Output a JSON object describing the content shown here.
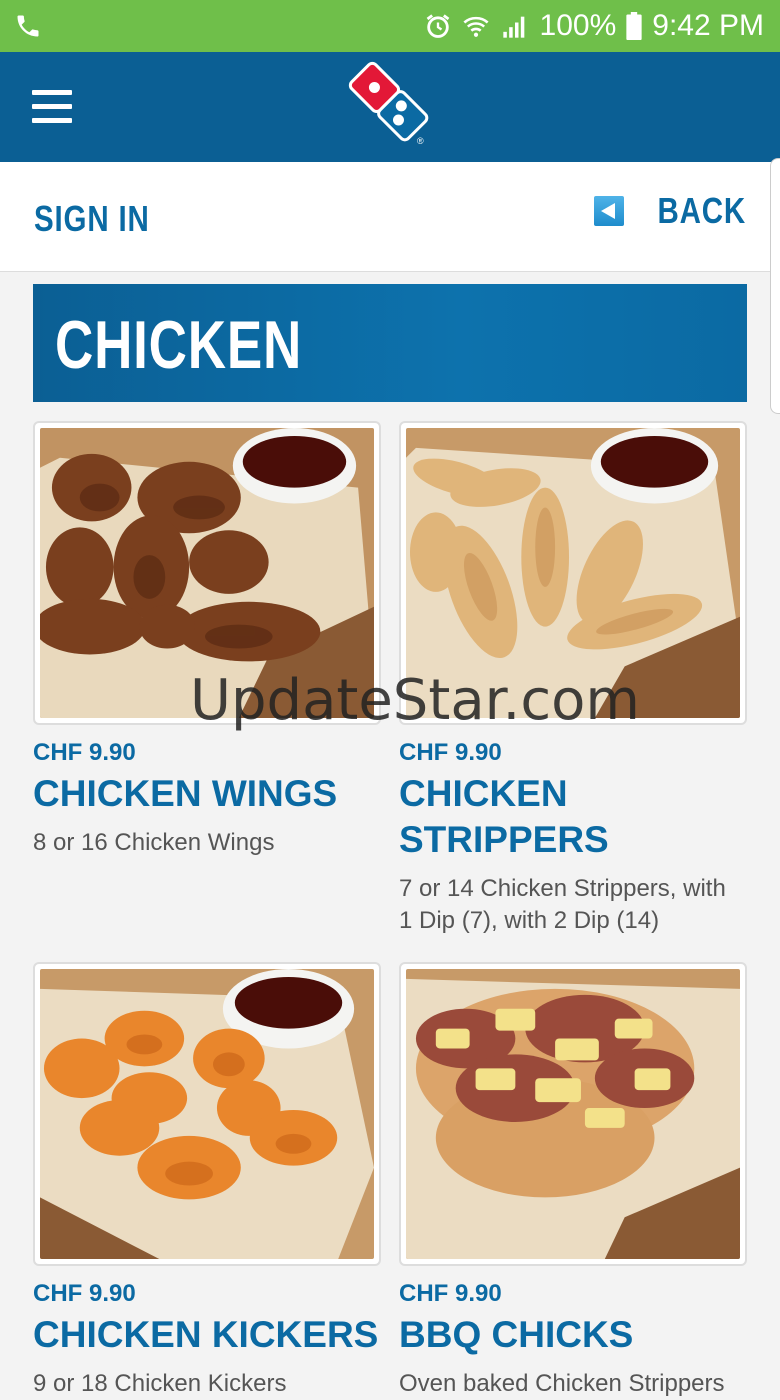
{
  "status_bar": {
    "battery": "100%",
    "time": "9:42 PM",
    "bg_color": "#6fbf4a",
    "icons": [
      "phone-icon",
      "alarm-icon",
      "wifi-icon",
      "signal-icon",
      "battery-icon"
    ]
  },
  "app_bar": {
    "bg_color": "#0b5f94",
    "menu_icon": "hamburger-menu-icon",
    "logo": "dominos-logo"
  },
  "nav": {
    "sign_in": "SIGN IN",
    "back": "BACK",
    "accent_color": "#0b6aa3"
  },
  "category": {
    "title": "CHICKEN"
  },
  "watermark": "UpdateStar.com",
  "products": [
    {
      "price": "CHF 9.90",
      "name": "CHICKEN WINGS",
      "desc": "8 or 16 Chicken Wings"
    },
    {
      "price": "CHF 9.90",
      "name": "CHICKEN STRIPPERS",
      "desc": "7 or 14 Chicken Strippers, with 1 Dip (7), with 2 Dip (14)"
    },
    {
      "price": "CHF 9.90",
      "name": "CHICKEN KICKERS",
      "desc": "9 or 18 Chicken Kickers"
    },
    {
      "price": "CHF 9.90",
      "name": "BBQ CHICKS",
      "desc": "Oven baked Chicken Strippers"
    }
  ]
}
